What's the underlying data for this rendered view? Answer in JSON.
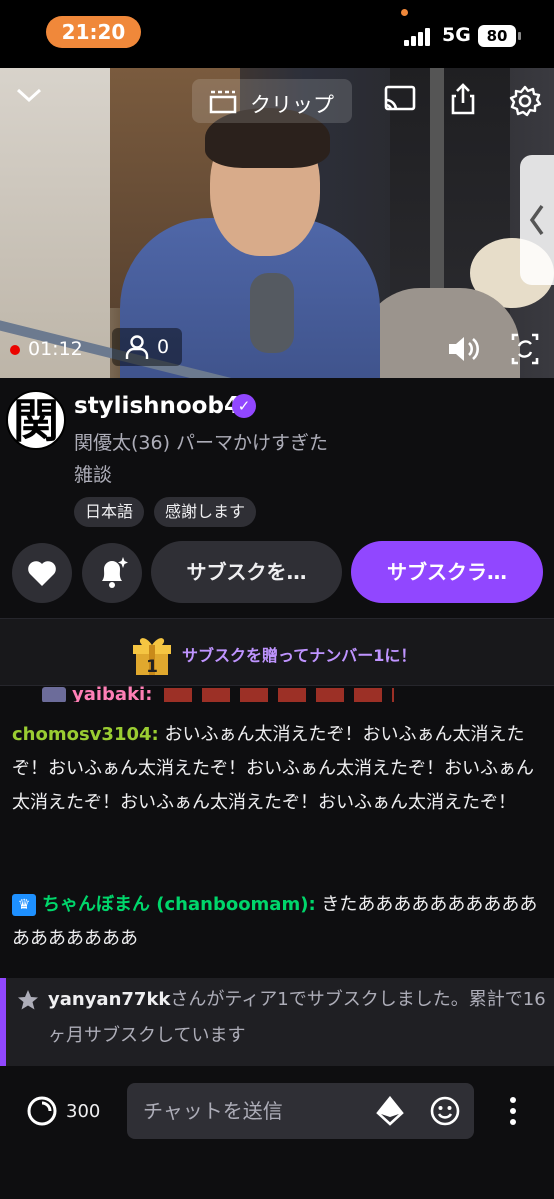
{
  "status_bar": {
    "time": "21:20",
    "network": "5G",
    "battery": "80"
  },
  "player": {
    "clip_label": "クリップ",
    "elapsed": "01:12",
    "viewers": "0"
  },
  "channel": {
    "avatar_text": "関",
    "name": "stylishnoob4",
    "title": "関優太(36) パーマかけすぎた",
    "category": "雑談",
    "tags": [
      "日本語",
      "感謝します"
    ]
  },
  "actions": {
    "gift_sub_label": "サブスクを…",
    "subscribe_label": "サブスクラ…"
  },
  "gift_banner": {
    "text": "サブスクを贈ってナンバー1に！",
    "badge": "1"
  },
  "chat": {
    "messages": [
      {
        "user": "yaibaki:",
        "text": "",
        "user_color": "#ff7fb6"
      },
      {
        "user": "chomosv3104:",
        "text": "おいふぁん太消えたぞ！おいふぁん太消えたぞ！おいふぁん太消えたぞ！おいふぁん太消えたぞ！おいふぁん太消えたぞ！おいふぁん太消えたぞ！おいふぁん太消えたぞ！",
        "user_color": "#9acd32"
      },
      {
        "user": "ちゃんぼまん (chanboomam):",
        "text": "きたあああああああああああああああああ",
        "user_color": "#00d66b"
      }
    ],
    "sub_notice": {
      "user": "yanyan77kk",
      "text": "さんがティア1でサブスクしました。累計で16ヶ月サブスクしています"
    }
  },
  "bottom_bar": {
    "points": "300",
    "chat_placeholder": "チャットを送信"
  },
  "colors": {
    "brand_purple": "#9147ff",
    "live_red": "#eb0400",
    "status_orange": "#f0883a"
  }
}
